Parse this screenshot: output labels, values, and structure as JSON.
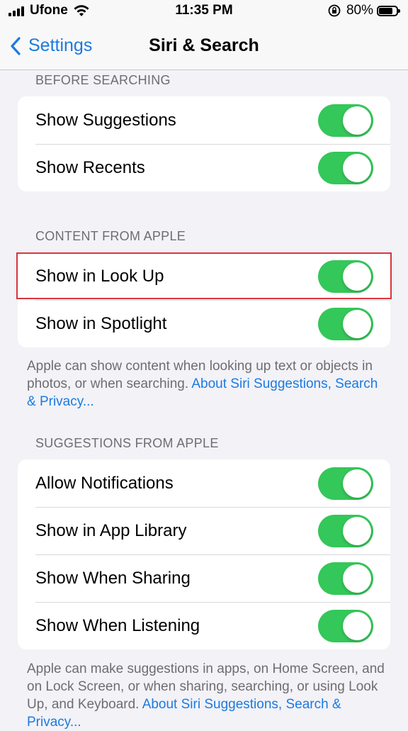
{
  "status_bar": {
    "carrier": "Ufone",
    "time": "11:35 PM",
    "battery_percent": "80%",
    "battery_level": 0.8,
    "icons": [
      "signal-icon",
      "wifi-icon",
      "orientation-lock-icon",
      "battery-icon"
    ]
  },
  "nav": {
    "back_label": "Settings",
    "title": "Siri & Search"
  },
  "sections": {
    "before_searching": {
      "header": "BEFORE SEARCHING",
      "items": [
        {
          "label": "Show Suggestions",
          "on": true
        },
        {
          "label": "Show Recents",
          "on": true
        }
      ]
    },
    "content_from_apple": {
      "header": "CONTENT FROM APPLE",
      "items": [
        {
          "label": "Show in Look Up",
          "on": true,
          "highlighted": true
        },
        {
          "label": "Show in Spotlight",
          "on": true
        }
      ],
      "footer_text": "Apple can show content when looking up text or objects in photos, or when searching.",
      "footer_link": "About Siri Suggestions, Search & Privacy..."
    },
    "suggestions_from_apple": {
      "header": "SUGGESTIONS FROM APPLE",
      "items": [
        {
          "label": "Allow Notifications",
          "on": true
        },
        {
          "label": "Show in App Library",
          "on": true
        },
        {
          "label": "Show When Sharing",
          "on": true
        },
        {
          "label": "Show When Listening",
          "on": true
        }
      ],
      "footer_text": "Apple can make suggestions in apps, on Home Screen, and on Lock Screen, or when sharing, searching, or using Look Up, and Keyboard.",
      "footer_link": "About Siri Suggestions, Search & Privacy..."
    }
  },
  "colors": {
    "accent": "#1c7ae0",
    "toggle_on": "#34c759",
    "highlight": "#d9363e",
    "background": "#f2f2f7"
  }
}
